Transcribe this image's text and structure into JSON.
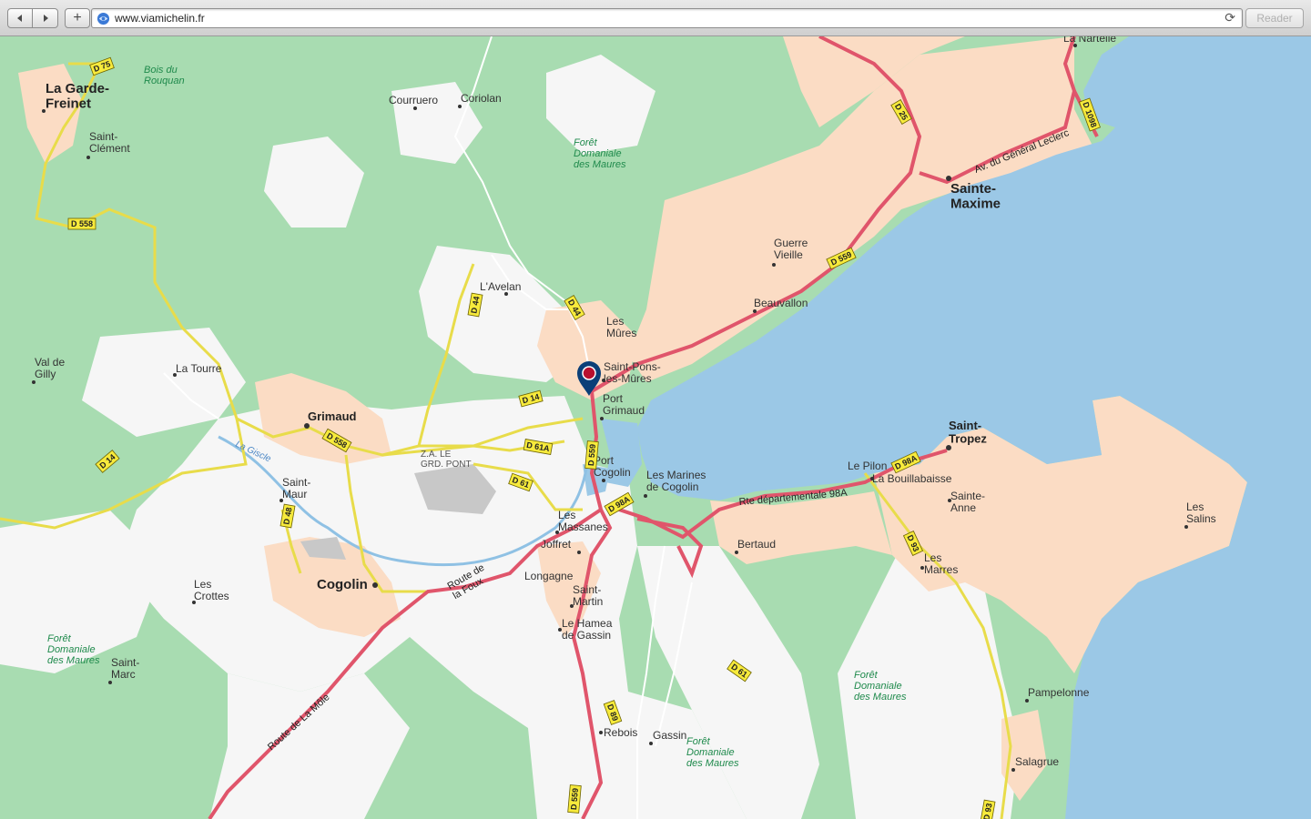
{
  "browser": {
    "url": "www.viamichelin.fr",
    "back_icon": "back-arrow-icon",
    "forward_icon": "forward-arrow-icon",
    "add_label": "+",
    "reload_icon": "reload-icon",
    "reader_label": "Reader"
  },
  "map": {
    "colors": {
      "sea": "#9bc8e6",
      "forest": "#a8dcb1",
      "urban": "#fbdcc4",
      "open_land": "#f6f6f6",
      "primary_road": "#e0556b",
      "secondary_road": "#e8dc4a",
      "river": "#8fc1e4",
      "marker": "#0b3f78"
    },
    "places": [
      {
        "name": "La Garde-\nFreinet",
        "style": "town"
      },
      {
        "name": "Saint-\nClément",
        "style": "village"
      },
      {
        "name": "Courruero",
        "style": "village"
      },
      {
        "name": "Coriolan",
        "style": "village"
      },
      {
        "name": "L'Avelan",
        "style": "village"
      },
      {
        "name": "Les\nMûres",
        "style": "village"
      },
      {
        "name": "Saint-Pons-\nles-Mûres",
        "style": "village"
      },
      {
        "name": "Port\nGrimaud",
        "style": "village"
      },
      {
        "name": "Port\nCogolin",
        "style": "village"
      },
      {
        "name": "Les Marines\nde Cogolin",
        "style": "village"
      },
      {
        "name": "Guerre\nVieille",
        "style": "village"
      },
      {
        "name": "Beauvallon",
        "style": "village"
      },
      {
        "name": "Sainte-\nMaxime",
        "style": "city"
      },
      {
        "name": "La Nartelle",
        "style": "village"
      },
      {
        "name": "Val de\nGilly",
        "style": "village"
      },
      {
        "name": "La Tourre",
        "style": "village"
      },
      {
        "name": "Grimaud",
        "style": "town"
      },
      {
        "name": "Saint-\nMaur",
        "style": "village"
      },
      {
        "name": "Cogolin",
        "style": "city"
      },
      {
        "name": "Les\nCrottes",
        "style": "village"
      },
      {
        "name": "Saint-\nMarc",
        "style": "village"
      },
      {
        "name": "Les\nMassanes",
        "style": "village"
      },
      {
        "name": "Joffret",
        "style": "village"
      },
      {
        "name": "Longagne",
        "style": "village"
      },
      {
        "name": "Saint-\nMartin",
        "style": "village"
      },
      {
        "name": "Le Hamea\nde Gassin",
        "style": "village"
      },
      {
        "name": "Rebois",
        "style": "village"
      },
      {
        "name": "Gassin",
        "style": "village"
      },
      {
        "name": "Bertaud",
        "style": "village"
      },
      {
        "name": "Le Pilon",
        "style": "village"
      },
      {
        "name": "La Bouillabaisse",
        "style": "village"
      },
      {
        "name": "Saint-\nTropez",
        "style": "town"
      },
      {
        "name": "Sainte-\nAnne",
        "style": "village"
      },
      {
        "name": "Les\nMarres",
        "style": "village"
      },
      {
        "name": "Les\nSalins",
        "style": "village"
      },
      {
        "name": "Pampelonne",
        "style": "village"
      },
      {
        "name": "Salagrue",
        "style": "village"
      }
    ],
    "forests": [
      "Bois du\nRouquan",
      "Forêt\nDomaniale\ndes Maures",
      "Forêt\nDomaniale\ndes Maures",
      "Forêt\nDomaniale\ndes Maures",
      "Forêt\nDomaniale\ndes Maures"
    ],
    "zone_label": "Z.A. LE\nGRD. PONT",
    "river_label": "La Giscle",
    "road_names": [
      "Av. du Général Leclerc",
      "Route de\nla Foux",
      "Route de La Môle",
      "Rte départementale 98A"
    ],
    "road_shields": [
      "D 75",
      "D 558",
      "D 14",
      "D 48",
      "D 558",
      "D 44",
      "D 44",
      "D 14",
      "D 61A",
      "D 61",
      "D 559",
      "D 98A",
      "D 25",
      "D 559",
      "D 1098",
      "D 98A",
      "D 93",
      "D 61",
      "D 89",
      "D 559",
      "D 93"
    ],
    "marker_icon": "location-pin-icon"
  }
}
